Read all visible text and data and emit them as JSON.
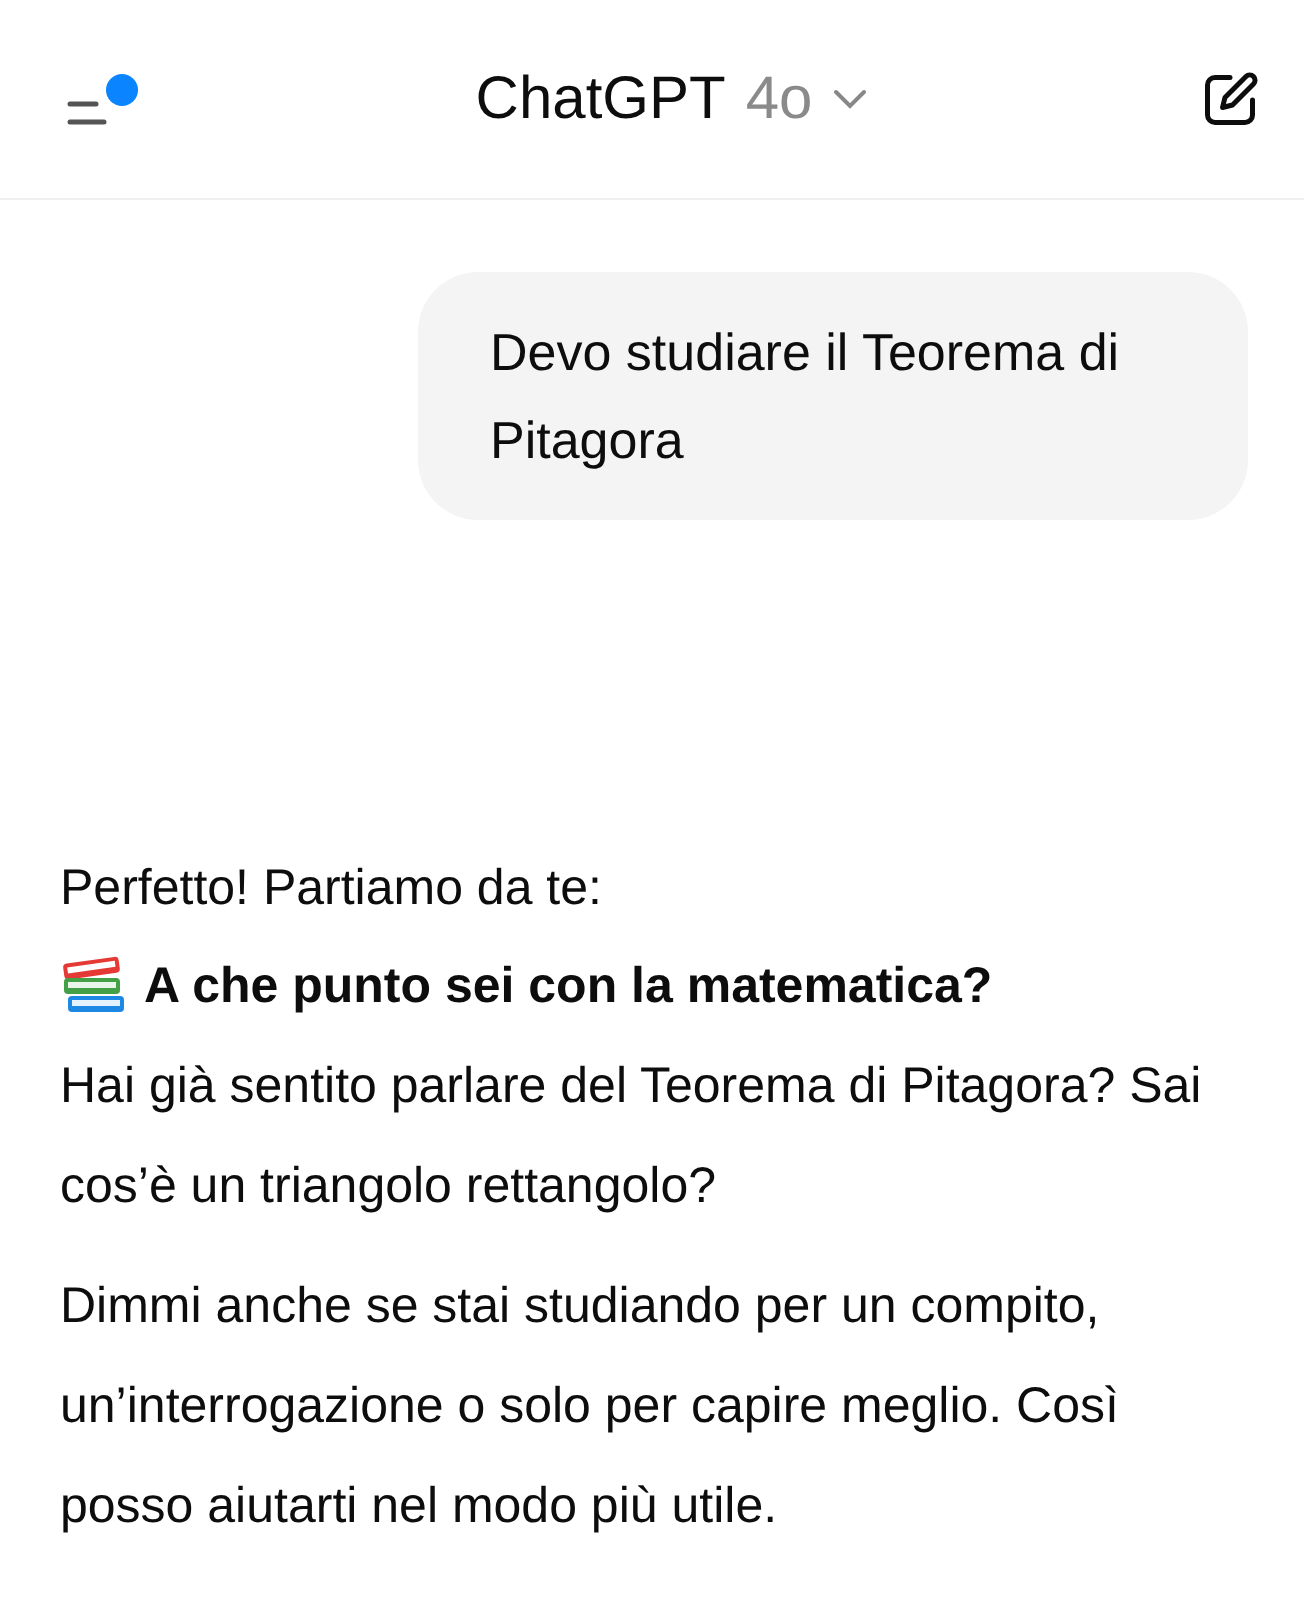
{
  "header": {
    "title": "ChatGPT",
    "model": "4o",
    "notification": true
  },
  "messages": [
    {
      "kind": "user",
      "text": "Devo studiare il Teorema di Pitagora"
    },
    {
      "kind": "assistant",
      "blocks": [
        {
          "kind": "line",
          "text": "Perfetto! Partiamo da te:"
        },
        {
          "kind": "heading",
          "text": "A che punto sei con la matematica?"
        },
        {
          "kind": "para",
          "text": "Hai già sentito parlare del Teorema di Pitagora? Sai cos’è un triangolo rettangolo?"
        },
        {
          "kind": "para",
          "text": "Dimmi anche se stai studiando per un compito, un’interrogazione o solo per capire meglio. Così posso aiutarti nel modo più utile."
        }
      ]
    }
  ]
}
